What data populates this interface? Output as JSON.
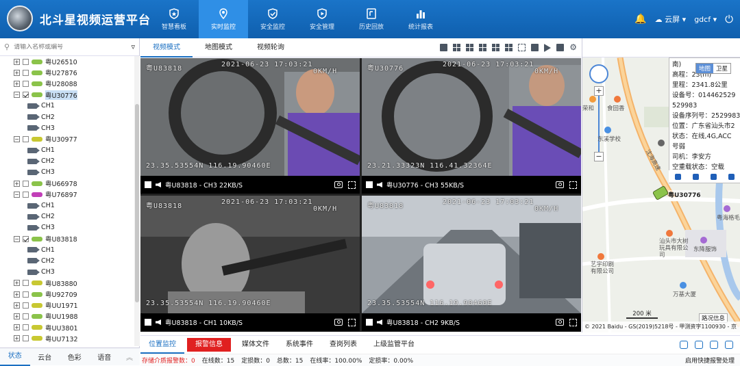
{
  "app": {
    "title": "北斗星视频运营平台"
  },
  "nav": [
    {
      "label": "智慧看板",
      "icon": "shield-star-icon"
    },
    {
      "label": "实时监控",
      "icon": "location-pin-icon",
      "active": true
    },
    {
      "label": "安全监控",
      "icon": "shield-check-icon"
    },
    {
      "label": "安全管理",
      "icon": "play-shield-icon"
    },
    {
      "label": "历史回放",
      "icon": "history-icon"
    },
    {
      "label": "统计报表",
      "icon": "bar-chart-icon"
    }
  ],
  "topright": {
    "cloud": "云屏",
    "user": "gdcf"
  },
  "search": {
    "placeholder": "请输入名称或编号"
  },
  "tree": [
    {
      "type": "veh",
      "label": "粤U26510",
      "color": "#8bc34a",
      "exp": "+"
    },
    {
      "type": "veh",
      "label": "粤U27876",
      "color": "#8bc34a",
      "exp": "+"
    },
    {
      "type": "veh",
      "label": "粤U28088",
      "color": "#8bc34a",
      "exp": "+"
    },
    {
      "type": "veh",
      "label": "粤U30776",
      "color": "#8bc34a",
      "exp": "−",
      "checked": true,
      "selected": true
    },
    {
      "type": "ch",
      "label": "CH1"
    },
    {
      "type": "ch",
      "label": "CH2"
    },
    {
      "type": "ch",
      "label": "CH3"
    },
    {
      "type": "veh",
      "label": "粤U30977",
      "color": "#c8c832",
      "exp": "−"
    },
    {
      "type": "ch",
      "label": "CH1"
    },
    {
      "type": "ch",
      "label": "CH2"
    },
    {
      "type": "ch",
      "label": "CH3"
    },
    {
      "type": "veh",
      "label": "粤U66978",
      "color": "#8bc34a",
      "exp": "+"
    },
    {
      "type": "veh",
      "label": "粤U76897",
      "color": "#c23fb8",
      "exp": "−"
    },
    {
      "type": "ch",
      "label": "CH1"
    },
    {
      "type": "ch",
      "label": "CH2"
    },
    {
      "type": "ch",
      "label": "CH3"
    },
    {
      "type": "veh",
      "label": "粤U83818",
      "color": "#8bc34a",
      "exp": "−",
      "checked": true
    },
    {
      "type": "ch",
      "label": "CH1"
    },
    {
      "type": "ch",
      "label": "CH2"
    },
    {
      "type": "ch",
      "label": "CH3"
    },
    {
      "type": "veh",
      "label": "粤U83880",
      "color": "#c8c832",
      "exp": "+"
    },
    {
      "type": "veh",
      "label": "粤U92709",
      "color": "#8bc34a",
      "exp": "+"
    },
    {
      "type": "veh",
      "label": "粤UU1971",
      "color": "#c8c832",
      "exp": "+"
    },
    {
      "type": "veh",
      "label": "粤UU1988",
      "color": "#8bc34a",
      "exp": "+"
    },
    {
      "type": "veh",
      "label": "粤UU3801",
      "color": "#c8c832",
      "exp": "+"
    },
    {
      "type": "veh",
      "label": "粤UU7132",
      "color": "#c8c832",
      "exp": "+"
    }
  ],
  "left_tabs": [
    "状态",
    "云台",
    "色彩",
    "语音"
  ],
  "view_tabs": [
    "视频模式",
    "地图模式",
    "视频轮询"
  ],
  "videos": [
    {
      "plate_osd": "粤U83818",
      "time_osd": "2021-06-23 17:03:21",
      "speed_osd": "0KM/H",
      "coord_osd": "23.35.53554N 116.19.90460E",
      "caption": "粤U83818 - CH3 22KB/S"
    },
    {
      "plate_osd": "粤U30776",
      "time_osd": "2021-06-23 17:03:21",
      "speed_osd": "0KM/H",
      "coord_osd": "23.21.33323N 116.41.32364E",
      "caption": "粤U30776 - CH3 55KB/S"
    },
    {
      "plate_osd": "粤U83818",
      "time_osd": "2021-06-23 17:03:21",
      "speed_osd": "0KM/H",
      "coord_osd": "23.35.53554N 116.19.90460E",
      "caption": "粤U83818 - CH1 10KB/S"
    },
    {
      "plate_osd": "粤U83818",
      "time_osd": "2021-06-23 17:03:21",
      "speed_osd": "0KM/H",
      "coord_osd": "23.35.53554N 116.19.90460E",
      "caption": "粤U83818 - CH2 9KB/S"
    }
  ],
  "info": {
    "lines": [
      "南)",
      "高程：23(m)",
      "里程：2341.8公里",
      "设备号：014462529",
      "529983",
      "设备序列号：2529983",
      "位置：广东省汕头市2",
      "状态：在线,4G,ACC",
      "号弱",
      "司机：李安方",
      "空重载状态：空载"
    ],
    "maptype": [
      "地图",
      "卫星"
    ]
  },
  "map": {
    "vehicle": "粤U30776",
    "pois": [
      "荣和",
      "食回香",
      "东溪学校",
      "沈海高速",
      "粤海格毛衫",
      "汕头市大树玩具有限公司",
      "东降服饰",
      "艺宇印刷有限公司",
      "万基大厦"
    ],
    "scale": "200 米",
    "traffic": "路况信息",
    "copyright": "© 2021 Baidu - GS(2019)5218号 - 甲测资字1100930 - 京"
  },
  "bottom_tabs": [
    "位置监控",
    "报警信息",
    "媒体文件",
    "系统事件",
    "查岗列表",
    "上级监管平台"
  ],
  "status": {
    "storage": "存储介质报警数：0",
    "online": "在线数：15",
    "located": "定损数：0",
    "total": "总数：15",
    "rate": "在线率：100.00%",
    "locrate": "定损率：0.00%",
    "quick": "启用快捷报警处理"
  }
}
